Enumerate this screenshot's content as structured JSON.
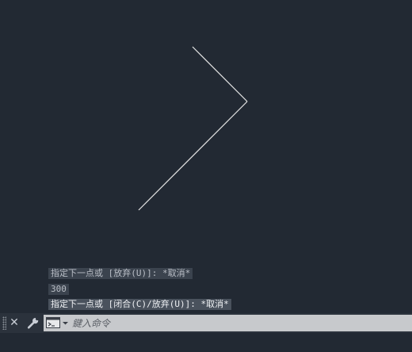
{
  "command_history": [
    "指定下一点或 [放弃(U)]: *取消*",
    "300",
    "指定下一点或 [闭合(C)/放弃(U)]: *取消*"
  ],
  "command_line": {
    "placeholder": "鍵入命令",
    "close_icon": "close-icon",
    "customize_icon": "wrench-icon",
    "prompt_icon": "command-prompt-icon"
  },
  "colors": {
    "canvas_background": "#222933",
    "line_color": "#e6e6e6",
    "input_background": "#c7c9cc"
  }
}
